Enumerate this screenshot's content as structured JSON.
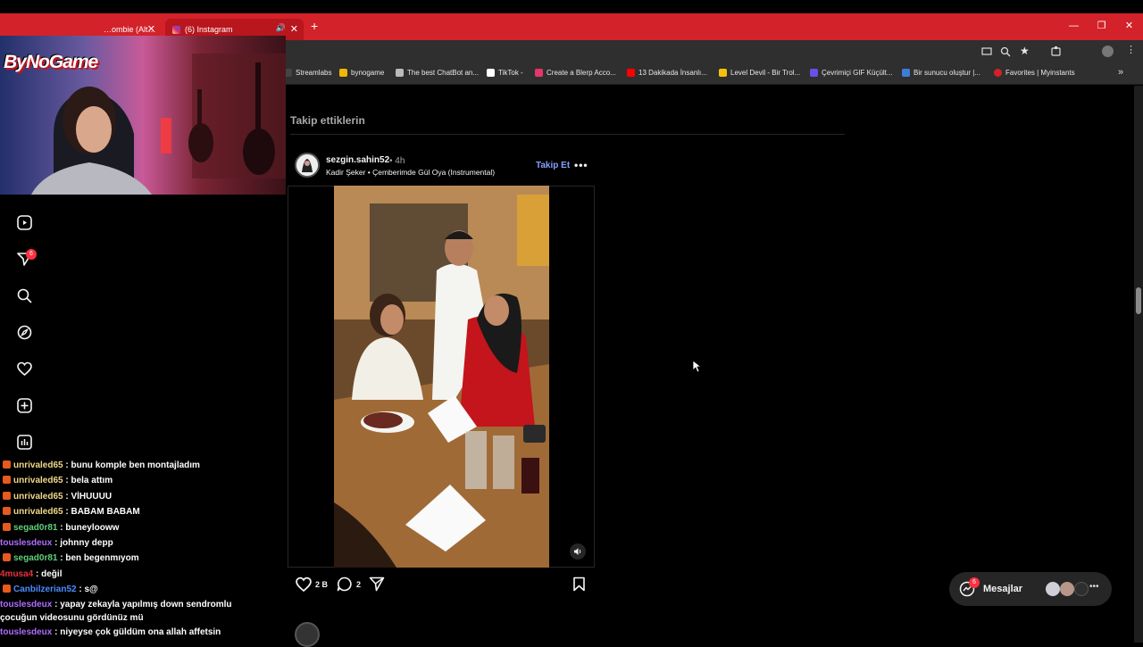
{
  "browser": {
    "tabs": [
      {
        "label": "…ombie (Alt…",
        "active": false
      },
      {
        "label": "(6) Instagram",
        "active": true
      }
    ],
    "bookmarks": [
      {
        "label": "Streamlabs",
        "color": "#2f2f2f"
      },
      {
        "label": "bynogame",
        "color": "#f2b705"
      },
      {
        "label": "The best ChatBot an...",
        "color": "#bbbbbb"
      },
      {
        "label": "TikTok -",
        "color": "#ffffff"
      },
      {
        "label": "Create a Blerp Acco...",
        "color": "#e6356b"
      },
      {
        "label": "13 Dakikada İnsanlı...",
        "color": "#ff0000"
      },
      {
        "label": "Level Devil - Bir Trol...",
        "color": "#f4c20d"
      },
      {
        "label": "Çevrimiçi GIF Küçült...",
        "color": "#6a4ee8"
      },
      {
        "label": "Bir sunucu oluştur |...",
        "color": "#3b7fd9"
      },
      {
        "label": "Favorites | Myinstants",
        "color": "#d4202a"
      }
    ]
  },
  "stream": {
    "logo": "ByNoGame"
  },
  "nav": {
    "notification_count": "6"
  },
  "chat": [
    {
      "user": "unrivaled65",
      "color": "#f0d88a",
      "text": " : bunu komple ben montajladım",
      "icon": true
    },
    {
      "user": "unrivaled65",
      "color": "#f0d88a",
      "text": " : bela attım",
      "icon": true
    },
    {
      "user": "unrivaled65",
      "color": "#f0d88a",
      "text": " : VİHUUUU",
      "icon": true
    },
    {
      "user": "unrivaled65",
      "color": "#f0d88a",
      "text": " : BABAM BABAM",
      "icon": true
    },
    {
      "user": "segad0r81",
      "color": "#5fd07a",
      "text": " : buneylooww",
      "icon": true
    },
    {
      "user": "touslesdeux",
      "color": "#b06cff",
      "text": " : johnny depp",
      "icon": false
    },
    {
      "user": "segad0r81",
      "color": "#5fd07a",
      "text": " : ben begenmıyom",
      "icon": true
    },
    {
      "user": "4musa4",
      "color": "#e8323c",
      "text": " : değil",
      "icon": false
    },
    {
      "user": "Canbilzerian52",
      "color": "#4a8cff",
      "text": " : s@",
      "icon": true
    },
    {
      "user": "touslesdeux",
      "color": "#b06cff",
      "text": " : yapay zekayla yapılmış down sendromlu çocuğun videosunu gördünüz mü",
      "icon": false,
      "wrap": true
    },
    {
      "user": "touslesdeux",
      "color": "#b06cff",
      "text": " : niyeyse çok güldüm ona allah affetsin",
      "icon": false
    }
  ],
  "feed": {
    "section_title": "Takip ettiklerin",
    "post": {
      "username": "sezgin.sahin52",
      "time": "• 4h",
      "audio": "Kadir Şeker • Çemberimde Gül Oya (Instrumental)",
      "follow_label": "Takip Et",
      "more_label": "•••",
      "likes": "2 B",
      "comments": "2"
    }
  },
  "messages": {
    "label": "Mesajlar",
    "badge": "6"
  }
}
